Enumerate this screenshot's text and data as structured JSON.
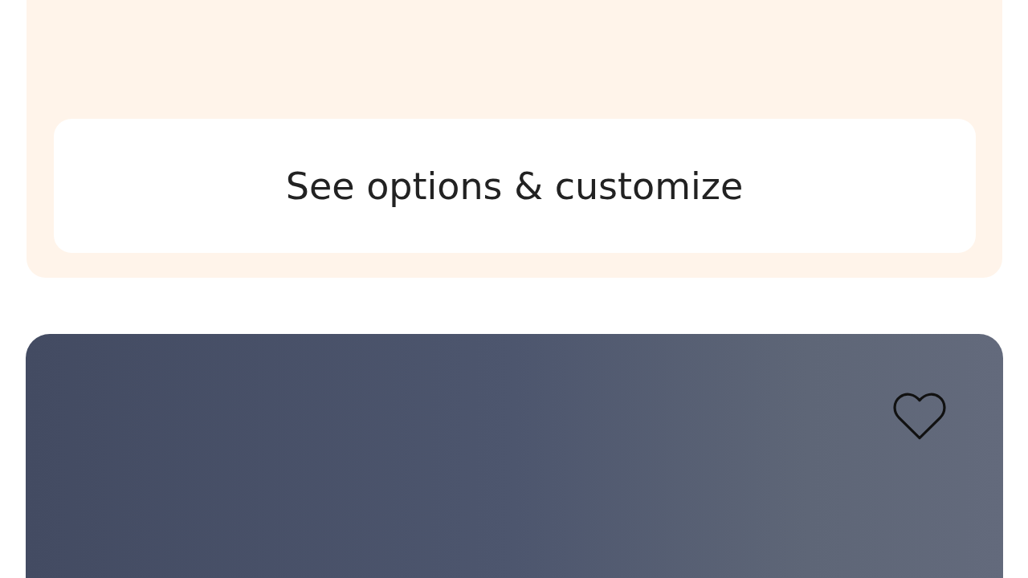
{
  "options_card": {
    "button": "See options & customize"
  },
  "product_card": {
    "favorited": false
  }
}
